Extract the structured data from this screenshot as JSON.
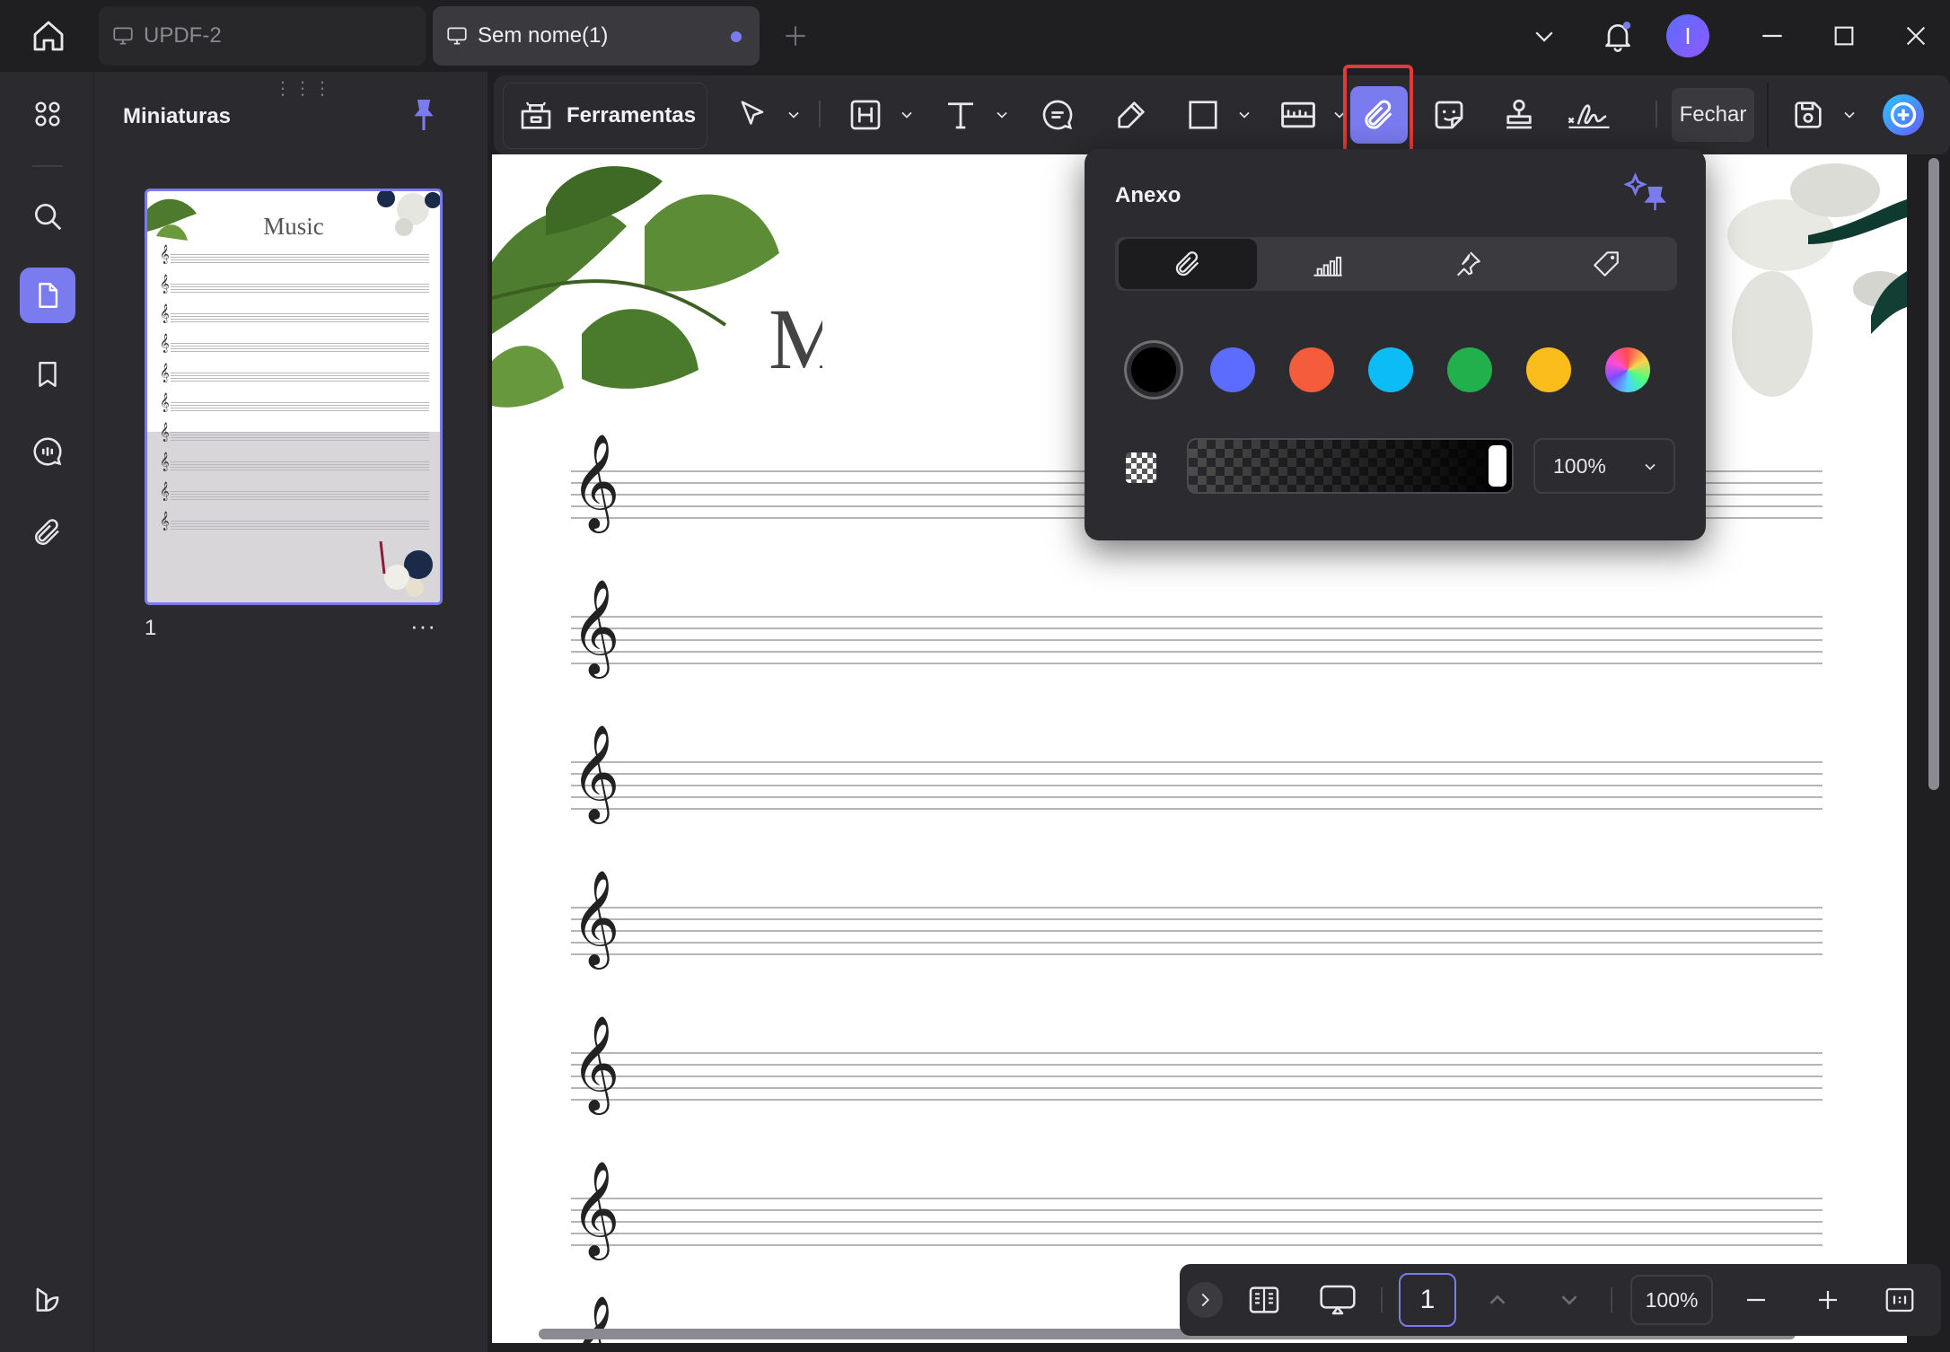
{
  "tabs": [
    {
      "label": "UPDF-2",
      "active": false
    },
    {
      "label": "Sem nome(1)",
      "active": true
    }
  ],
  "avatar_letter": "I",
  "thumbnails": {
    "title": "Miniaturas",
    "page_number": "1",
    "page_title": "Music",
    "more": "···"
  },
  "toolbar": {
    "tools_label": "Ferramentas",
    "close_label": "Fechar"
  },
  "popup": {
    "title": "Anexo",
    "colors": [
      "#000000",
      "#5b6cff",
      "#f45c3c",
      "#0bbcf5",
      "#21b04b",
      "#fbbd1c",
      "multicolor"
    ],
    "opacity": "100%"
  },
  "bottombar": {
    "page_input": "1",
    "zoom": "100%"
  },
  "colors": {
    "accent": "#7b7bf0",
    "highlight_border": "#e53935"
  }
}
